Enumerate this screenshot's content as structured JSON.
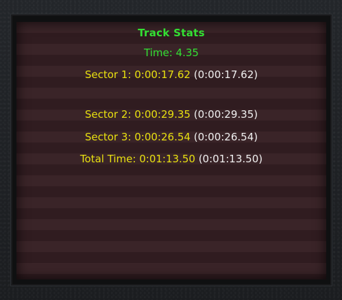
{
  "title": "Track Stats",
  "time": "Time: 4.35",
  "sectors": [
    {
      "label": "Sector 1:",
      "time": "0:00:17.62",
      "best": "(0:00:17.62)"
    },
    {
      "label": "Sector 2:",
      "time": "0:00:29.35",
      "best": "(0:00:29.35)"
    },
    {
      "label": "Sector 3:",
      "time": "0:00:26.54",
      "best": "(0:00:26.54)"
    }
  ],
  "total": {
    "label": "Total Time:",
    "time": "0:01:13.50",
    "best": "(0:01:13.50)"
  },
  "colors": {
    "title": "#33e033",
    "label": "#e8e010",
    "best": "#f0f0f0",
    "panel_stripe_a": "#3a2428",
    "panel_stripe_b": "#301c20"
  }
}
